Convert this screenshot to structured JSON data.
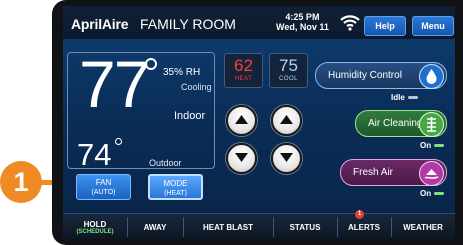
{
  "header": {
    "brand": "AprilAire",
    "room": "FAMILY ROOM",
    "time": "4:25 PM",
    "date": "Wed, Nov 11",
    "help_label": "Help",
    "menu_label": "Menu"
  },
  "indoor": {
    "temperature": "77",
    "humidity": "35% RH",
    "mode_status": "Cooling",
    "label": "Indoor"
  },
  "outdoor": {
    "temperature": "74",
    "label": "Outdoor"
  },
  "setpoints": {
    "heat_value": "62",
    "heat_label": "HEAT",
    "cool_value": "75",
    "cool_label": "COOL"
  },
  "iaq": {
    "humidity_control": {
      "label": "Humidity Control",
      "state": "Idle"
    },
    "air_cleaning": {
      "label": "Air Cleaning",
      "state": "On"
    },
    "fresh_air": {
      "label": "Fresh Air",
      "state": "On"
    }
  },
  "controls": {
    "fan_label": "FAN",
    "fan_value": "(AUTO)",
    "mode_label": "MODE",
    "mode_value": "(HEAT)"
  },
  "nav": {
    "hold_label": "HOLD",
    "hold_sub": "(SCHEDULE)",
    "away_label": "AWAY",
    "heat_blast_label": "HEAT BLAST",
    "status_label": "STATUS",
    "alerts_label": "ALERTS",
    "alerts_count": "1",
    "weather_label": "WEATHER"
  },
  "callout": {
    "number": "1"
  },
  "colors": {
    "heat": "#ff3b2f",
    "cool": "#7fc4ff",
    "status_on": "#7fe37a",
    "callout": "#f08a24"
  }
}
